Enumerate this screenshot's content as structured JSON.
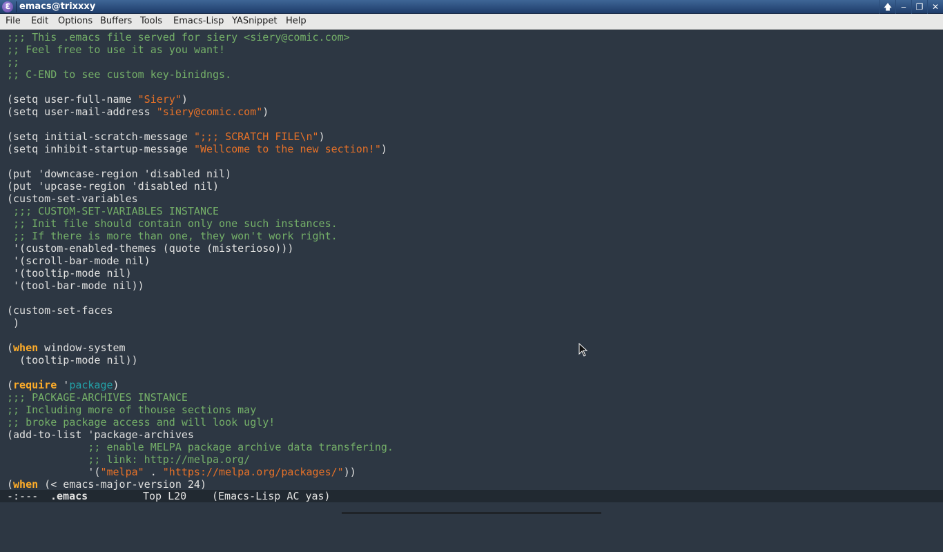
{
  "window": {
    "title": "emacs@trixxxy",
    "app_icon": "emacs-icon",
    "controls": [
      {
        "name": "keep-above-button",
        "glyph": "🡅"
      },
      {
        "name": "minimize-button",
        "glyph": "‒"
      },
      {
        "name": "maximize-button",
        "glyph": "❐"
      },
      {
        "name": "close-button",
        "glyph": "✕"
      }
    ]
  },
  "menubar": {
    "items": [
      "File",
      "Edit",
      "Options",
      "Buffers",
      "Tools",
      "Emacs-Lisp",
      "YASnippet",
      "Help"
    ]
  },
  "colors": {
    "background": "#2d3743",
    "comment": "#74af68",
    "string": "#e67128",
    "keyword": "#ffad29",
    "constant": "#23a2a8",
    "default": "#e1e1e0",
    "modeline": "#212931"
  },
  "buffer": {
    "lines": [
      [
        {
          "t": ";;; This .emacs file served for siery <siery@comic.com>",
          "f": "c"
        }
      ],
      [
        {
          "t": ";; Feel free to use it as you want!",
          "f": "c"
        }
      ],
      [
        {
          "t": ";;",
          "f": "c"
        }
      ],
      [
        {
          "t": ";; C-END to see custom key-binidngs.",
          "f": "c"
        }
      ],
      [],
      [
        {
          "t": "(setq user-full-name ",
          "f": ""
        },
        {
          "t": "\"Siery\"",
          "f": "s"
        },
        {
          "t": ")",
          "f": ""
        }
      ],
      [
        {
          "t": "(setq user-mail-address ",
          "f": ""
        },
        {
          "t": "\"siery@comic.com\"",
          "f": "s"
        },
        {
          "t": ")",
          "f": ""
        }
      ],
      [],
      [
        {
          "t": "(setq initial-scratch-message ",
          "f": ""
        },
        {
          "t": "\";;; SCRATCH FILE\\n\"",
          "f": "s"
        },
        {
          "t": ")",
          "f": ""
        }
      ],
      [
        {
          "t": "(setq inhibit-startup-message ",
          "f": ""
        },
        {
          "t": "\"Wellcome to the new section!\"",
          "f": "s"
        },
        {
          "t": ")",
          "f": ""
        }
      ],
      [],
      [
        {
          "t": "(put 'downcase-region 'disabled nil)",
          "f": ""
        }
      ],
      [
        {
          "t": "(put 'upcase-region 'disabled nil)",
          "f": ""
        }
      ],
      [
        {
          "t": "(custom-set-variables",
          "f": ""
        }
      ],
      [
        {
          "t": " ;;; CUSTOM-SET-VARIABLES INSTANCE",
          "f": "c"
        }
      ],
      [
        {
          "t": " ;; Init file should contain only one such instances.",
          "f": "c"
        }
      ],
      [
        {
          "t": " ;; If there is more than one, they won't work right.",
          "f": "c"
        }
      ],
      [
        {
          "t": " '(custom-enabled-themes (quote (misterioso)))",
          "f": ""
        }
      ],
      [
        {
          "t": " '(scroll-bar-mode nil)",
          "f": ""
        }
      ],
      [
        {
          "t": " '(tooltip-mode nil)",
          "f": ""
        }
      ],
      [
        {
          "t": " '(tool-bar-mode nil))",
          "f": ""
        }
      ],
      [],
      [
        {
          "t": "(custom-set-faces",
          "f": ""
        }
      ],
      [
        {
          "t": " )",
          "f": ""
        }
      ],
      [],
      [
        {
          "t": "(",
          "f": ""
        },
        {
          "t": "when",
          "f": "k"
        },
        {
          "t": " window-system",
          "f": ""
        }
      ],
      [
        {
          "t": "  (tooltip-mode nil))",
          "f": ""
        }
      ],
      [],
      [
        {
          "t": "(",
          "f": ""
        },
        {
          "t": "require",
          "f": "k"
        },
        {
          "t": " '",
          "f": ""
        },
        {
          "t": "package",
          "f": "t"
        },
        {
          "t": ")",
          "f": ""
        }
      ],
      [
        {
          "t": ";;; PACKAGE-ARCHIVES INSTANCE",
          "f": "c"
        }
      ],
      [
        {
          "t": ";; Including more of thouse sections may",
          "f": "c"
        }
      ],
      [
        {
          "t": ";; broke package access and will look ugly!",
          "f": "c"
        }
      ],
      [
        {
          "t": "(add-to-list 'package-archives",
          "f": ""
        }
      ],
      [
        {
          "t": "             ",
          "f": ""
        },
        {
          "t": ";; enable MELPA package archive data transfering.",
          "f": "c"
        }
      ],
      [
        {
          "t": "             ",
          "f": ""
        },
        {
          "t": ";; link: http://melpa.org/",
          "f": "c"
        }
      ],
      [
        {
          "t": "             '(",
          "f": ""
        },
        {
          "t": "\"melpa\"",
          "f": "s"
        },
        {
          "t": " . ",
          "f": ""
        },
        {
          "t": "\"https://melpa.org/packages/\"",
          "f": "s"
        },
        {
          "t": "))",
          "f": ""
        }
      ],
      [
        {
          "t": "(",
          "f": ""
        },
        {
          "t": "when",
          "f": "k"
        },
        {
          "t": " (< emacs-major-version 24)",
          "f": ""
        }
      ]
    ]
  },
  "modeline": {
    "status": "-:---",
    "buffer_name": ".emacs",
    "position": "Top L20",
    "modes": "(Emacs-Lisp AC yas)"
  }
}
